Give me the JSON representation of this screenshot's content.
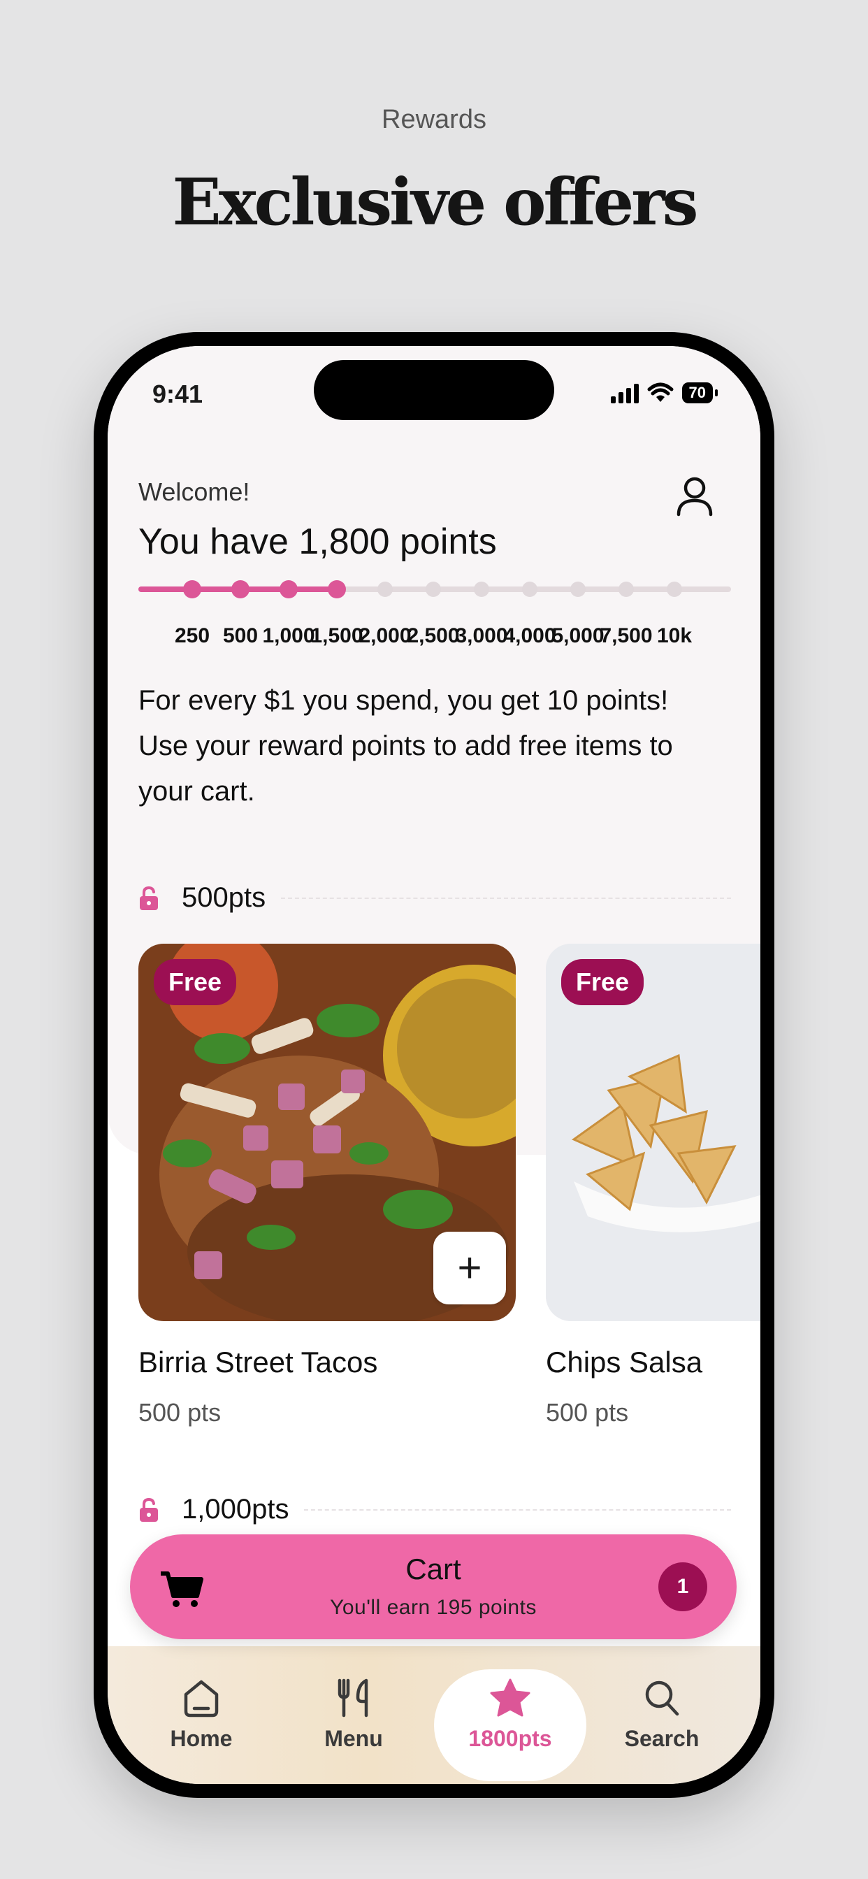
{
  "marketing": {
    "subtitle": "Rewards",
    "title": "Exclusive offers"
  },
  "status_bar": {
    "time": "9:41",
    "battery": "70"
  },
  "header": {
    "welcome": "Welcome!",
    "points_title": "You have 1,800 points",
    "profile_icon": "user-icon",
    "progress_fraction": 0.34,
    "milestones": [
      "250",
      "500",
      "1,000",
      "1,500",
      "2,000",
      "2,500",
      "3,000",
      "4,000",
      "5,000",
      "7,500",
      "10k"
    ],
    "milestones_reached": 4,
    "description": "For every $1 you spend, you get 10 points! Use your reward points to add free items to your cart."
  },
  "sections": [
    {
      "label": "500pts",
      "items": [
        {
          "badge": "Free",
          "name": "Birria Street Tacos",
          "points": "500 pts",
          "add_label": "+"
        },
        {
          "badge": "Free",
          "name": "Chips Salsa",
          "points": "500 pts"
        }
      ]
    },
    {
      "label": "1,000pts"
    }
  ],
  "cart": {
    "title": "Cart",
    "subtitle": "You'll earn 195 points",
    "count": "1"
  },
  "nav": [
    {
      "label": "Home",
      "icon": "home-icon"
    },
    {
      "label": "Menu",
      "icon": "utensils-icon"
    },
    {
      "label": "1800pts",
      "icon": "star-icon",
      "active": true
    },
    {
      "label": "Search",
      "icon": "search-icon"
    }
  ],
  "colors": {
    "accent": "#dc5697",
    "cart": "#ef68a7",
    "badge": "#9c0f53"
  }
}
